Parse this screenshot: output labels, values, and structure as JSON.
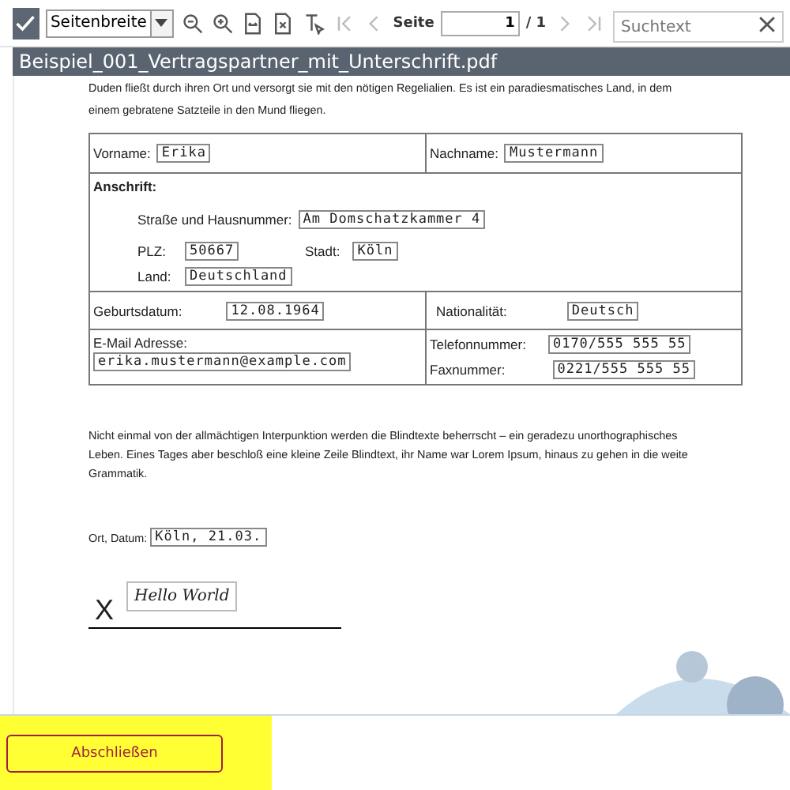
{
  "toolbar": {
    "zoom_mode": "Seitenbreite",
    "tools": [
      {
        "kind": "zoom-out",
        "disabled": false
      },
      {
        "kind": "zoom-in",
        "disabled": false
      },
      {
        "kind": "fit-width",
        "disabled": false
      },
      {
        "kind": "fit-page",
        "disabled": false
      },
      {
        "kind": "text-select",
        "disabled": false
      },
      {
        "kind": "first",
        "disabled": true
      },
      {
        "kind": "prev",
        "disabled": true
      }
    ],
    "page_label": "Seite",
    "page_value": "1",
    "page_total": "/ 1",
    "after_tools": [
      {
        "kind": "next",
        "disabled": true
      },
      {
        "kind": "last",
        "disabled": true
      }
    ],
    "search": {
      "placeholder": "Suchtext"
    }
  },
  "document": {
    "title": "Beispiel_001_Vertragspartner_mit_Unterschrift.pdf",
    "intro": [
      "Duden fließt durch ihren Ort und versorgt sie mit den nötigen Regelialien. Es ist ein paradiesmatisches Land, in dem",
      "einem gebratene Satzteile in den Mund fliegen."
    ],
    "form": {
      "first_name": {
        "label": "Vorname:",
        "value": "Erika"
      },
      "last_name": {
        "label": "Nachname:",
        "value": "Mustermann"
      },
      "address_heading": "Anschrift:",
      "street": {
        "label": "Straße und Hausnummer:",
        "value": "Am Domschatzkammer 4"
      },
      "zip": {
        "label": "PLZ:",
        "value": "50667"
      },
      "city": {
        "label": "Stadt:",
        "value": "Köln"
      },
      "country": {
        "label": "Land:",
        "value": "Deutschland"
      },
      "birth_date": {
        "label": "Geburtsdatum:",
        "value": "12.08.1964"
      },
      "nationality": {
        "label": "Nationalität:",
        "value": "Deutsch"
      },
      "email": {
        "label": "E-Mail Adresse:",
        "value": "erika.mustermann@example.com"
      },
      "phone": {
        "label": "Telefonnummer:",
        "value": "0170/555 555 55"
      },
      "fax": {
        "label": "Faxnummer:",
        "value": "0221/555 555 55"
      }
    },
    "paragraph": "Nicht einmal von der allmächtigen Interpunktion werden die Blindtexte beherrscht – ein geradezu unorthographisches Leben. Eines Tages aber beschloß eine kleine Zeile Blindtext, ihr Name war Lorem Ipsum, hinaus zu gehen in die weite Grammatik.",
    "place_date": {
      "label": "Ort, Datum:",
      "value": "Köln, 21.03."
    },
    "signature": {
      "mark": "X",
      "text": "Hello World"
    }
  },
  "footer": {
    "button": "Abschließen"
  }
}
